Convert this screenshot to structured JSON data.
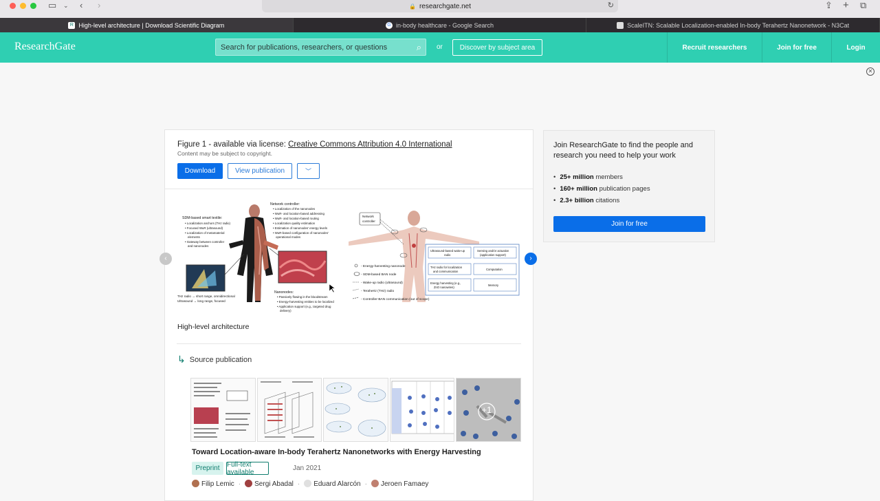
{
  "browser": {
    "url": "researchgate.net",
    "tabs": [
      {
        "title": "High-level architecture | Download Scientific Diagram",
        "active": true
      },
      {
        "title": "in-body healthcare - Google Search",
        "active": false
      },
      {
        "title": "ScaleITN: Scalable Localization-enabled In-body Terahertz Nanonetwork - N3Cat",
        "active": false
      }
    ]
  },
  "header": {
    "logo": "ResearchGate",
    "search_placeholder": "Search for publications, researchers, or questions",
    "or_label": "or",
    "discover_label": "Discover by subject area",
    "nav": {
      "recruit": "Recruit researchers",
      "join": "Join for free",
      "login": "Login"
    },
    "brand_color": "#2fcfb2"
  },
  "figure": {
    "title_prefix": "Figure 1 - available via license: ",
    "license": "Creative Commons Attribution 4.0 International",
    "subtitle": "Content may be subject to copyright.",
    "download_label": "Download",
    "view_label": "View publication",
    "caption": "High-level architecture",
    "diagram": {
      "textile_title": "SDM-based smart textile:",
      "textile_items": [
        "Localization anchors (THz radio)",
        "Focused WuR (ultrasound)",
        "Localization of metamaterial",
        "elements",
        "Gateway between controller",
        "and nanonodes"
      ],
      "controller_title": "Network controller:",
      "controller_items": [
        "Localization of the nanonodes",
        "WuR- and location-based addressing",
        "WuR- and location-based routing",
        "Localization quality estimation",
        "Estimation of nanonodes' energy levels",
        "WuR-based configuration of nanonodes'",
        "operational modes"
      ],
      "thz_line": "THz radio → short range, omnidirectional",
      "us_line": "Ultrasound → long range, focused",
      "nano_title": "Nanonodes:",
      "nano_items": [
        "Passively flowing in the bloodstream",
        "Energy-harvesting entities to be localized",
        "Application support (e.g., targeted drug",
        "delivery)"
      ],
      "net_ctrl": "Network controller",
      "legend": [
        "Energy-harvesting nanonode",
        "SDM-based BAN node",
        "Wake-up radio (ultrasound)",
        "Terahertz (THz) radio",
        "Controller-BAN communication (out of scope)"
      ],
      "boxes": [
        "Ultrasound-based wake-up radio",
        "Sensing and/or actuation (application support)",
        "THz radio for localization and communication",
        "Computation",
        "Energy harvesting (e.g., ZnO nanowires)",
        "Memory"
      ]
    }
  },
  "source": {
    "label": "Source publication",
    "title": "Toward Location-aware In-body Terahertz Nanonetworks with Energy Harvesting",
    "badge_preprint": "Preprint",
    "badge_fulltext": "Full-text available",
    "date": "Jan 2021",
    "authors": [
      "Filip Lemic",
      "Sergi Abadal",
      "Eduard Alarcón",
      "Jeroen Famaey"
    ],
    "thumb_more": "+1"
  },
  "side": {
    "heading": "Join ResearchGate to find the people and research you need to help your work",
    "stats": [
      {
        "bold": "25+ million",
        "text": " members"
      },
      {
        "bold": "160+ million",
        "text": " publication pages"
      },
      {
        "bold": "2.3+ billion",
        "text": " citations"
      }
    ],
    "button": "Join for free"
  }
}
